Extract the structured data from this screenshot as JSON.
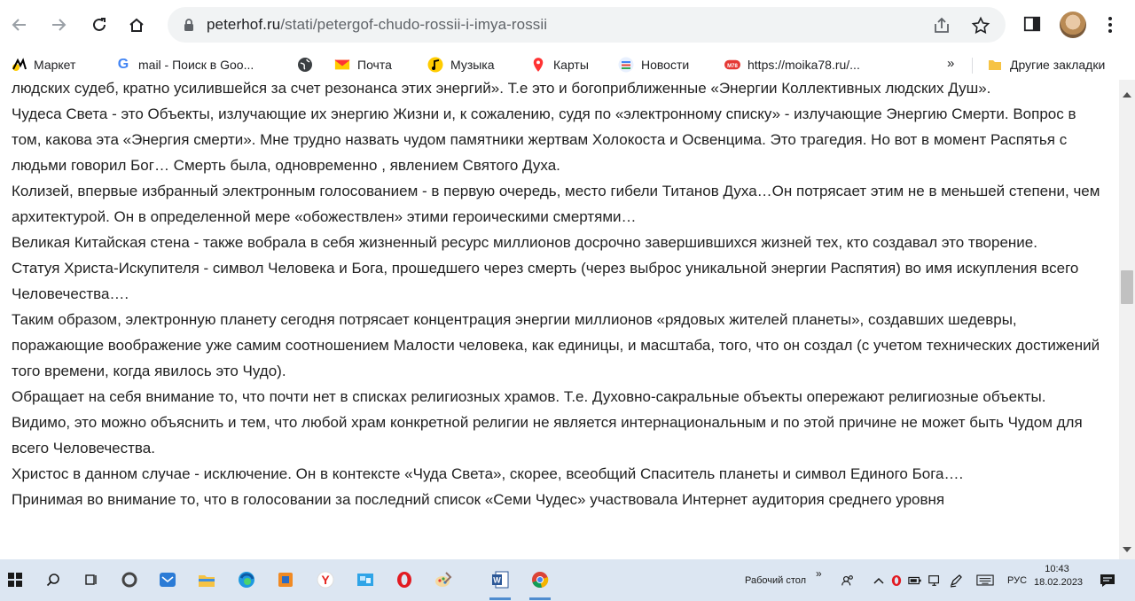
{
  "browser": {
    "url_host": "peterhof.ru",
    "url_path": "/stati/petergof-chudo-rossii-i-imya-rossii",
    "icons": [
      "back-icon",
      "forward-icon",
      "reload-icon",
      "home-icon",
      "lock-icon",
      "share-icon",
      "star-icon",
      "sidepanel-icon",
      "avatar",
      "menu-icon"
    ]
  },
  "bookmarks": {
    "items": [
      {
        "label": "Маркет",
        "icon": "yandex-market-icon"
      },
      {
        "label": "mail - Поиск в Goo...",
        "icon": "google-icon"
      },
      {
        "label": "",
        "icon": "globe-icon"
      },
      {
        "label": "Почта",
        "icon": "mail-icon"
      },
      {
        "label": "Музыка",
        "icon": "music-icon"
      },
      {
        "label": "Карты",
        "icon": "maps-icon"
      },
      {
        "label": "Новости",
        "icon": "news-icon"
      },
      {
        "label": "https://moika78.ru/...",
        "icon": "moika78-icon"
      }
    ],
    "more": "»",
    "other_folder": "Другие закладки"
  },
  "article": {
    "paragraphs": [
      "людских судеб, кратно усилившейся за счет резонанса этих энергий». Т.е это и богоприближенные «Энергии Коллективных людских Душ».",
      "Чудеса Света - это Объекты, излучающие их энергию Жизни и, к сожалению, судя по «электронному списку» - излучающие Энергию Смерти. Вопрос в том, какова эта «Энергия смерти». Мне трудно назвать чудом памятники жертвам Холокоста и Освенцима. Это трагедия. Но вот в момент Распятья с людьми говорил Бог… Смерть была, одновременно , явлением Святого Духа.",
      "Колизей, впервые избранный электронным голосованием - в первую очередь, место гибели Титанов Духа…Он потрясает этим не в меньшей степени, чем архитектурой. Он в определенной мере «обожествлен» этими героическими смертями…",
      "Великая Китайская стена - также вобрала в себя жизненный ресурс миллионов досрочно завершившихся жизней тех, кто создавал это творение.",
      "Статуя Христа-Искупителя - символ Человека и Бога, прошедшего через смерть (через выброс уникальной энергии Распятия) во имя искупления всего Человечества….",
      "Таким образом, электронную планету сегодня потрясает концентрация энергии миллионов «рядовых жителей планеты», создавших шедевры, поражающие воображение уже самим соотношением Малости человека, как единицы, и масштаба, того, что он создал (с учетом технических достижений того времени, когда явилось это Чудо).",
      "Обращает на себя внимание то, что почти нет в списках религиозных храмов. Т.е. Духовно-сакральные объекты опережают религиозные объекты. Видимо, это можно объяснить и тем, что любой храм конкретной религии не является интернациональным и по этой причине не может быть Чудом для всего Человечества.",
      "Христос в данном случае - исключение. Он в контексте «Чуда Света», скорее, всеобщий Спаситель планеты и символ Единого Бога….",
      "Принимая во внимание то, что в голосовании за последний список «Семи Чудес» участвовала Интернет аудитория среднего уровня"
    ]
  },
  "taskbar": {
    "desktop_label": "Рабочий стол",
    "language": "РУС",
    "time": "10:43",
    "date": "18.02.2023"
  },
  "colors": {
    "toolbar_bg": "#ffffff",
    "omnibox_bg": "#f1f3f4",
    "taskbar_bg": "#dce6f2",
    "text": "#222222"
  }
}
